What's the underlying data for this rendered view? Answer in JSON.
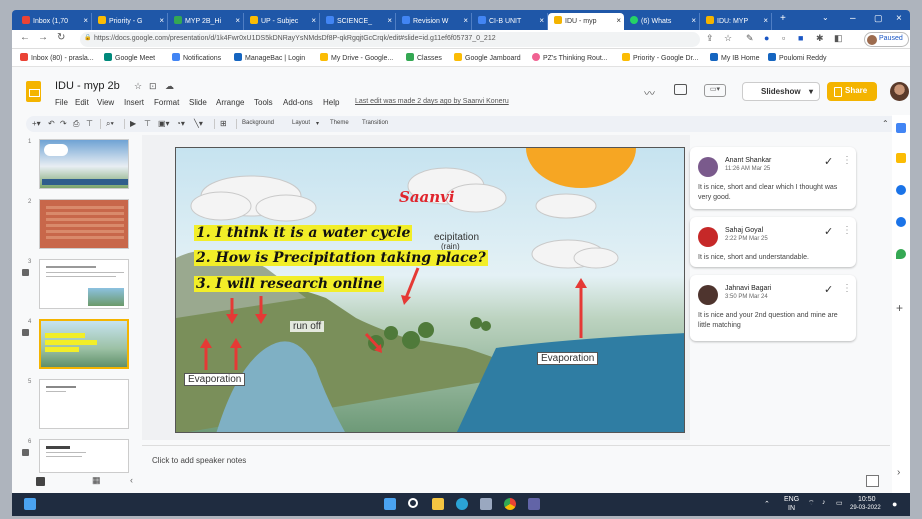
{
  "tabs": [
    {
      "label": "Inbox (1,70",
      "color": "#ea4335"
    },
    {
      "label": "Priority - G",
      "color": "#fbbc04"
    },
    {
      "label": "MYP 2B_Hi",
      "color": "#34a853"
    },
    {
      "label": "UP - Subjec",
      "color": "#fbbc04"
    },
    {
      "label": "SCIENCE_",
      "color": "#4285f4"
    },
    {
      "label": "Revision W",
      "color": "#4285f4"
    },
    {
      "label": "CI-B UNIT",
      "color": "#4285f4"
    },
    {
      "label": "IDU - myp",
      "color": "#f4b400"
    },
    {
      "label": "(6) Whats",
      "color": "#25d366"
    },
    {
      "label": "IDU: MYP",
      "color": "#f4b400"
    }
  ],
  "address": "https://docs.google.com/presentation/d/1k4Fwr0xU1DS5kDNRayYsNMdsDf8P-qkRgqjtGcCrqk/edit#slide=id.g11ef6f05737_0_212",
  "profile_label": "Paused",
  "bookmarks": [
    {
      "label": "Inbox (80) - prasla...",
      "color": "#ea4335"
    },
    {
      "label": "Google Meet",
      "color": "#00897b"
    },
    {
      "label": "Notifications",
      "color": "#4285f4"
    },
    {
      "label": "ManageBac | Login",
      "color": "#1565c0"
    },
    {
      "label": "My Drive - Google...",
      "color": "#fbbc04"
    },
    {
      "label": "Classes",
      "color": "#34a853"
    },
    {
      "label": "Google Jamboard",
      "color": "#fbbc04"
    },
    {
      "label": "PZ's Thinking Rout...",
      "color": "#f06292"
    },
    {
      "label": "Priority - Google Dr...",
      "color": "#fbbc04"
    },
    {
      "label": "My IB Home",
      "color": "#1565c0"
    },
    {
      "label": "Poulomi Reddy",
      "color": "#1565c0"
    }
  ],
  "doc_title": "IDU - myp 2b",
  "menus": [
    "File",
    "Edit",
    "View",
    "Insert",
    "Format",
    "Slide",
    "Arrange",
    "Tools",
    "Add-ons",
    "Help"
  ],
  "last_edit": "Last edit was made 2 days ago by Saanvi Koneru",
  "slideshow_label": "Slideshow",
  "share_label": "Share",
  "toolbar": {
    "background": "Background",
    "layout": "Layout",
    "theme": "Theme",
    "transition": "Transition"
  },
  "slide_numbers": [
    "1",
    "2",
    "3",
    "4",
    "5",
    "6"
  ],
  "slide": {
    "author": "Saanvi",
    "questions": [
      "1.  I think it is a water cycle",
      "2.  How is Precipitation taking place?",
      "3.  I will research online"
    ],
    "precip_label": "ecipitation",
    "precip_sub": "(rain)",
    "runoff_label": "run off",
    "evap_left": "Evaporation",
    "evap_right": "Evaporation"
  },
  "speaker_notes_placeholder": "Click to add speaker notes",
  "comments": [
    {
      "name": "Anant Shankar",
      "time": "11:26 AM Mar 25",
      "text": "It is nice, short and clear which I thought was very good.",
      "avatar_color": "#7a5a8c"
    },
    {
      "name": "Sahaj Goyal",
      "time": "2:22 PM Mar 25",
      "text": "It is nice, short and understandable.",
      "avatar_color": "#c62828"
    },
    {
      "name": "Jahnavi Bagari",
      "time": "3:50 PM Mar 24",
      "text": "It is nice and your 2nd question and mine are little matching",
      "avatar_color": "#4e342e"
    }
  ],
  "taskbar": {
    "lang": "ENG",
    "region": "IN",
    "time": "10:50",
    "date": "29-03-2022"
  }
}
